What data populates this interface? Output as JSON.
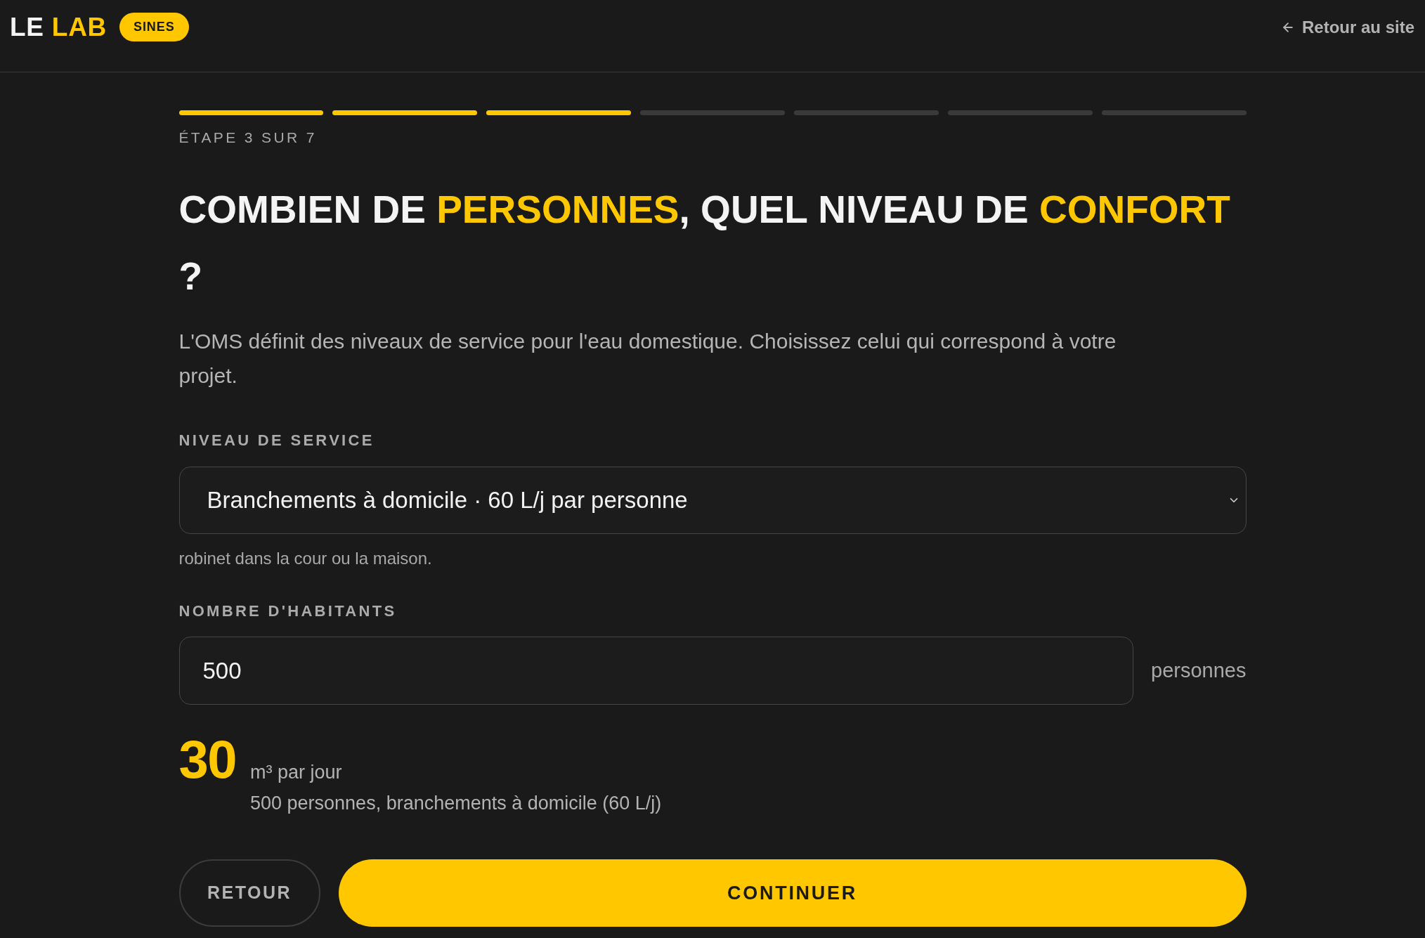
{
  "header": {
    "logo": {
      "parts": [
        {
          "text": "LE",
          "highlight": false
        },
        {
          "text": "LAB",
          "highlight": true
        }
      ]
    },
    "badge": "SINES",
    "back_link": "Retour au site"
  },
  "progress": {
    "steps": [
      {
        "completed": true
      },
      {
        "completed": true
      },
      {
        "completed": true
      },
      {
        "completed": false
      },
      {
        "completed": false
      },
      {
        "completed": false
      },
      {
        "completed": false
      }
    ],
    "label": "ÉTAPE 3 SUR 7"
  },
  "title": {
    "parts": [
      {
        "text": "COMBIEN DE ",
        "highlight": false
      },
      {
        "text": "PERSONNES",
        "highlight": true
      },
      {
        "text": ", QUEL NIVEAU DE ",
        "highlight": false
      },
      {
        "text": "CONFORT",
        "highlight": true
      },
      {
        "text": " ?",
        "highlight": false
      }
    ]
  },
  "description": "L'OMS définit des niveaux de service pour l'eau domestique. Choisissez celui qui correspond à votre projet.",
  "fields": [
    {
      "kind": "select",
      "label": "NIVEAU DE SERVICE",
      "value": "Branchements à domicile · 60 L/j par personne",
      "hint": "robinet dans la cour ou la maison."
    },
    {
      "kind": "number",
      "label": "NOMBRE D'HABITANTS",
      "value": "500",
      "suffix": "personnes"
    }
  ],
  "result": {
    "value": "30",
    "unit": "m³ par jour",
    "detail": "500 personnes, branchements à domicile (60 L/j)"
  },
  "buttons": [
    {
      "label": "RETOUR",
      "kind": "secondary"
    },
    {
      "label": "CONTINUER",
      "kind": "primary"
    }
  ]
}
